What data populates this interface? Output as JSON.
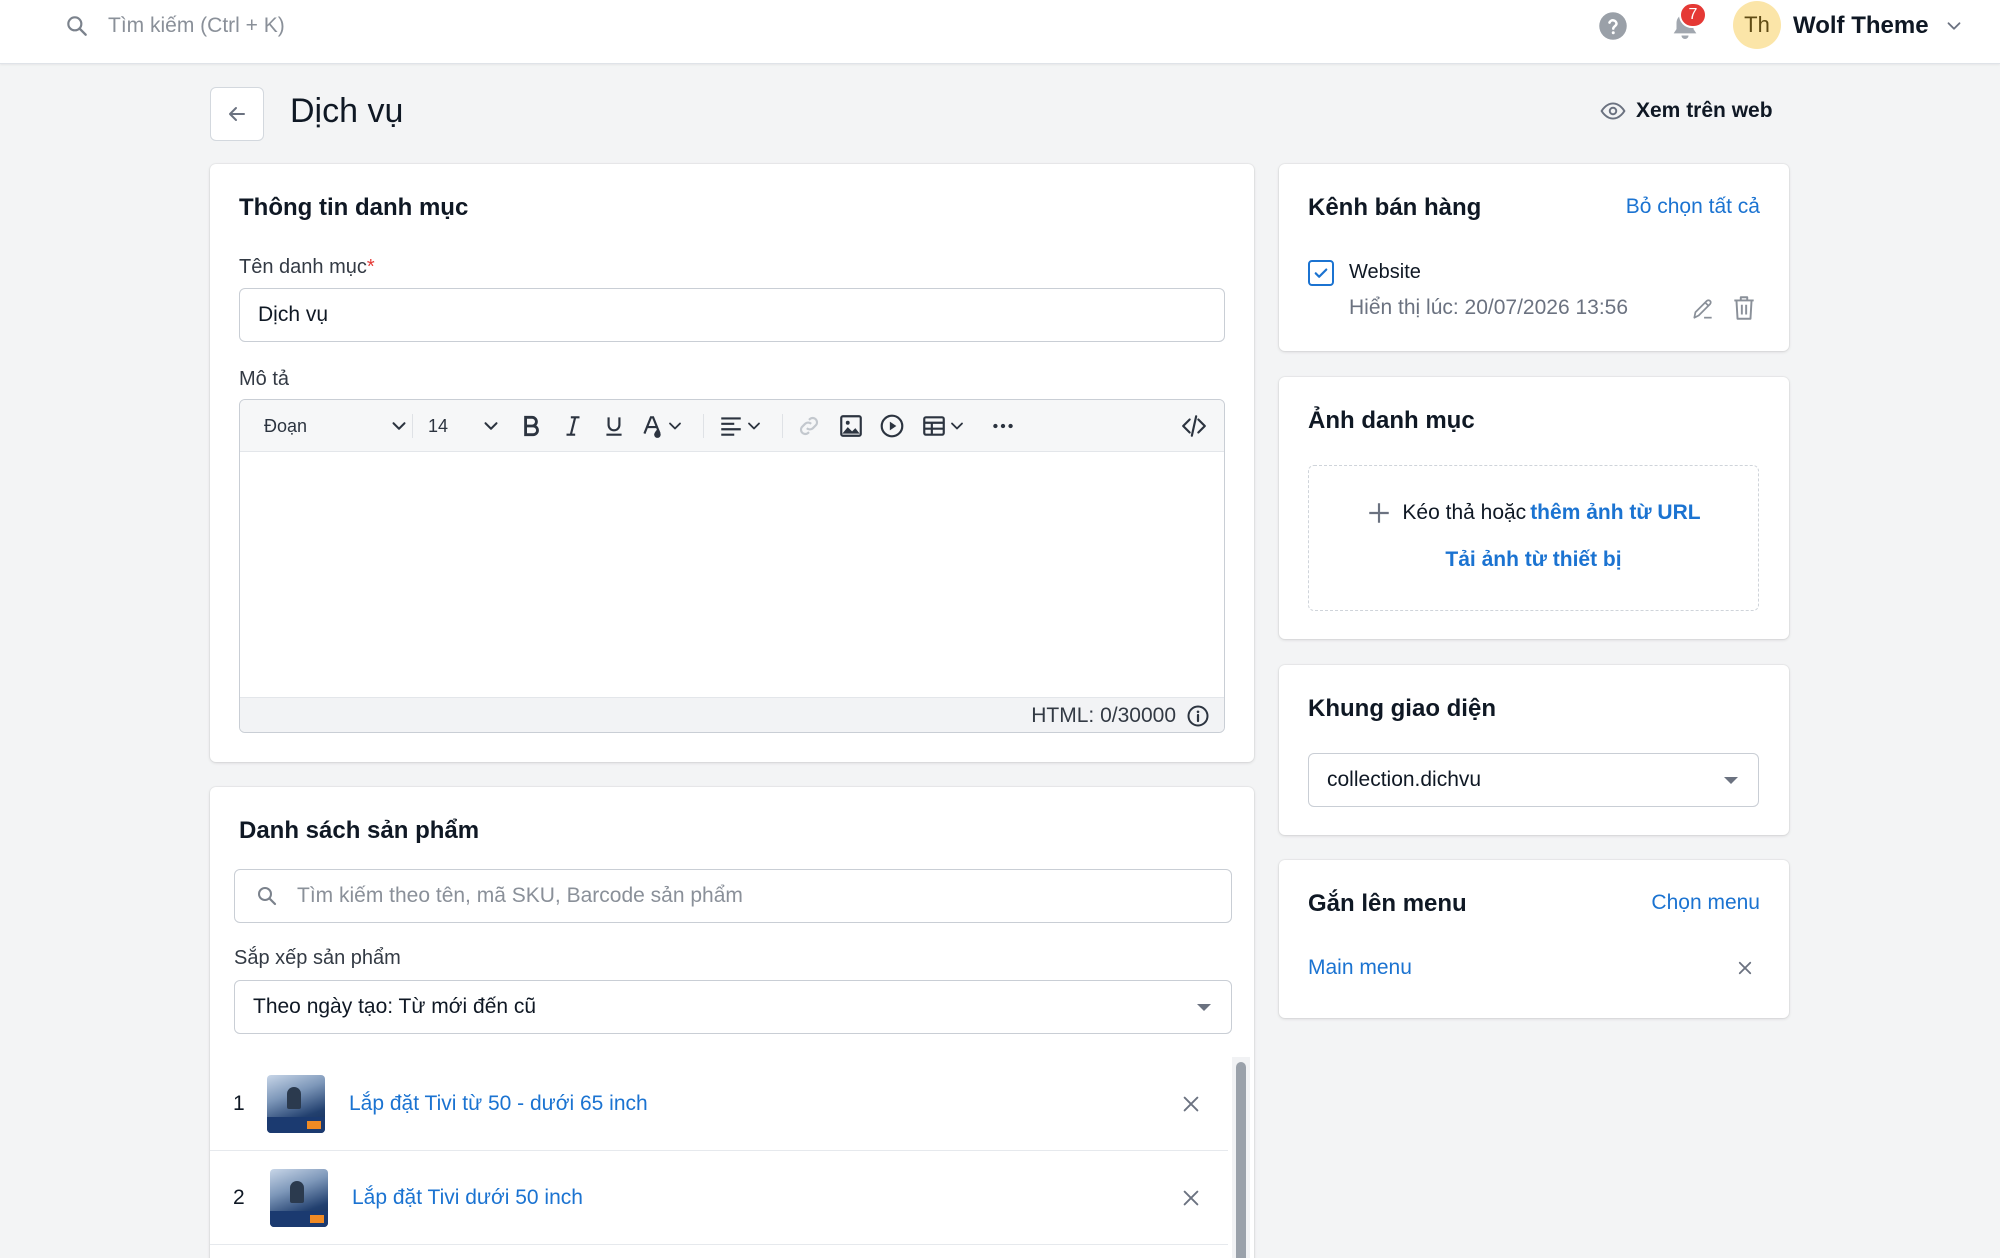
{
  "topbar": {
    "search_placeholder": "Tìm kiếm (Ctrl + K)",
    "notification_count": "7",
    "avatar_initials": "Th",
    "user_name": "Wolf Theme"
  },
  "header": {
    "title": "Dịch vụ",
    "view_on_web": "Xem trên web"
  },
  "category_info": {
    "title": "Thông tin danh mục",
    "name_label": "Tên danh mục",
    "required_mark": "*",
    "name_value": "Dịch vụ",
    "description_label": "Mô tả",
    "editor": {
      "paragraph_style": "Đoạn",
      "font_size": "14",
      "html_counter": "HTML: 0/30000"
    }
  },
  "products": {
    "title": "Danh sách sản phẩm",
    "search_placeholder": "Tìm kiếm theo tên, mã SKU, Barcode sản phẩm",
    "sort_label": "Sắp xếp sản phẩm",
    "sort_value": "Theo ngày tạo: Từ mới đến cũ",
    "items": [
      {
        "index": "1",
        "name": "Lắp đặt Tivi từ 50 - dưới 65 inch"
      },
      {
        "index": "2",
        "name": "Lắp đặt Tivi dưới 50 inch"
      }
    ]
  },
  "sales_channels": {
    "title": "Kênh bán hàng",
    "deselect_all": "Bỏ chọn tất cả",
    "channel": {
      "name": "Website",
      "checked": true,
      "display_time": "Hiển thị lúc: 20/07/2026 13:56"
    }
  },
  "category_image": {
    "title": "Ảnh danh mục",
    "drag_text": "Kéo thả hoặc",
    "add_url_link": "thêm ảnh từ URL",
    "upload_link": "Tải ảnh từ thiết bị"
  },
  "template": {
    "title": "Khung giao diện",
    "value": "collection.dichvu"
  },
  "menu": {
    "title": "Gắn lên menu",
    "choose_menu": "Chọn menu",
    "item": "Main menu"
  },
  "colors": {
    "accent": "#1b73d1",
    "badge": "#e53935",
    "avatar_bg": "#fbe5a8",
    "background": "#f3f4f5"
  }
}
